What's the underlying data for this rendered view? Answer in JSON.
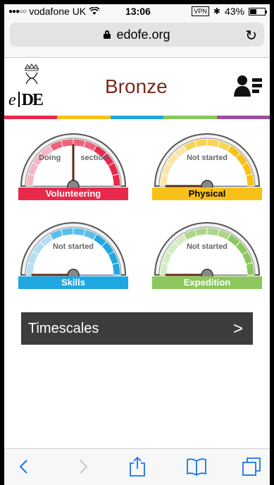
{
  "status_bar": {
    "carrier": "vodafone UK",
    "time": "13:06",
    "vpn": "VPN",
    "battery": "43%",
    "battery_level": 0.43
  },
  "browser": {
    "url": "edofe.org"
  },
  "header": {
    "logo_e": "e",
    "logo_de": "DE",
    "title": "Bronze"
  },
  "colors": {
    "title": "#7a2a1e",
    "stripe": [
      "#e8294c",
      "#f7c11a",
      "#1fa7e2",
      "#8cc85d",
      "#9b4f9e"
    ]
  },
  "sections": [
    {
      "name": "Volunteering",
      "status_left": "Doing",
      "status_right": "section",
      "color": "#e8294c",
      "light": "#f6b6c3",
      "needle": 0.5
    },
    {
      "name": "Physical",
      "status": "Not started",
      "color": "#f7c11a",
      "light": "#fbe6a8",
      "needle": 0.0
    },
    {
      "name": "Skills",
      "status": "Not started",
      "color": "#1fa7e2",
      "light": "#b5def4",
      "needle": 0.0
    },
    {
      "name": "Expedition",
      "status": "Not started",
      "color": "#8cc85d",
      "light": "#d4ecc2",
      "needle": 0.0
    }
  ],
  "timescales": {
    "label": "Timescales"
  }
}
